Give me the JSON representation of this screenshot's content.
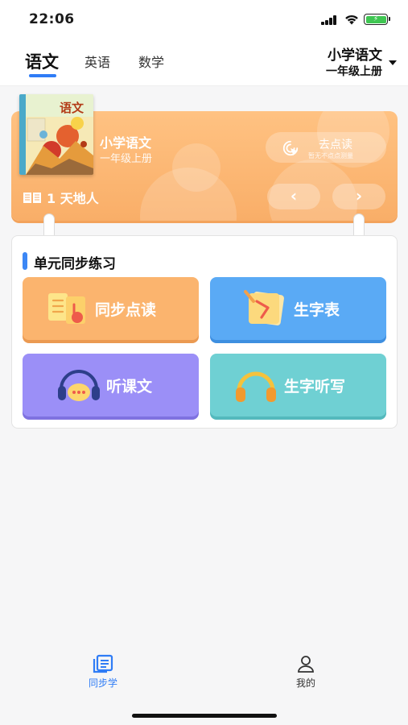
{
  "status": {
    "time": "22:06"
  },
  "topnav": {
    "tabs": [
      {
        "label": "语文",
        "active": true
      },
      {
        "label": "英语",
        "active": false
      },
      {
        "label": "数学",
        "active": false
      }
    ],
    "book_title": "小学语文",
    "book_volume": "一年级上册"
  },
  "banner": {
    "cover_label": "语文",
    "title": "小学语文",
    "subtitle": "一年级上册",
    "read_button": "去点读",
    "read_hint": "暂无不点点测量",
    "days_label": "1 天地人",
    "prev": "‹",
    "next": "›"
  },
  "practice": {
    "title": "单元同步练习",
    "tiles": [
      {
        "label": "同步点读",
        "color": "#fbb46e"
      },
      {
        "label": "生字表",
        "color": "#5aaaf5"
      },
      {
        "label": "听课文",
        "color": "#9b8ff7"
      },
      {
        "label": "生字听写",
        "color": "#6fd0d3"
      }
    ]
  },
  "tabbar": {
    "items": [
      {
        "label": "同步学",
        "active": true,
        "icon": "book-list-icon"
      },
      {
        "label": "我的",
        "active": false,
        "icon": "user-icon"
      }
    ]
  },
  "colors": {
    "accent": "#2f7cf6",
    "banner": "#f9ae68"
  }
}
